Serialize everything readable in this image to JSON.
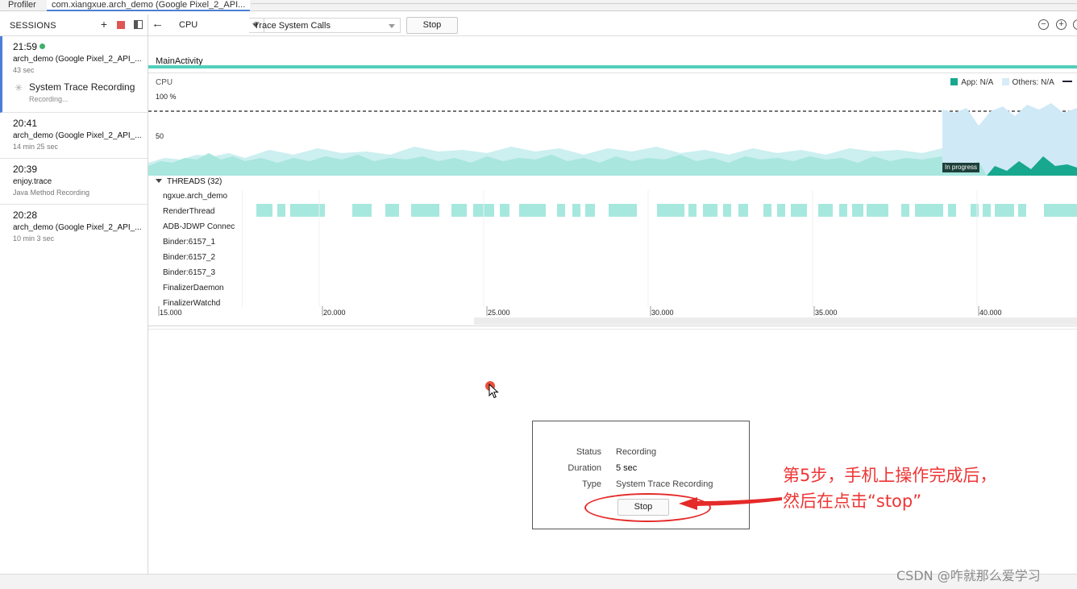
{
  "tabs": {
    "profiler": "Profiler",
    "session": "com.xiangxue.arch_demo (Google Pixel_2_API..."
  },
  "sidebar": {
    "title": "SESSIONS",
    "add_icon": "+",
    "sessions": [
      {
        "time": "21:59",
        "name": "arch_demo (Google Pixel_2_API_...",
        "duration": "43 sec",
        "recording_title": "System Trace Recording",
        "recording_status": "Recording..."
      },
      {
        "time": "20:41",
        "name": "arch_demo (Google Pixel_2_API_...",
        "duration": "14 min 25 sec"
      },
      {
        "time": "20:39",
        "name": "enjoy.trace",
        "duration": "Java Method Recording"
      },
      {
        "time": "20:28",
        "name": "arch_demo (Google Pixel_2_API_...",
        "duration": "10 min 3 sec"
      }
    ]
  },
  "toolbar": {
    "back_icon": "←",
    "monitor": "CPU",
    "trace_config": "Trace System Calls",
    "stop_label": "Stop",
    "zoom_out": "−",
    "zoom_in": "+",
    "zoom_reset": ""
  },
  "timeline": {
    "activity": "MainActivity",
    "cpu_label": "CPU",
    "cpu_max": "100 %",
    "cpu_mid": "50",
    "legend": {
      "app": "App: N/A",
      "others": "Others: N/A"
    },
    "in_progress": "In progress",
    "threads_header": "THREADS (32)",
    "threads": [
      "ngxue.arch_demo",
      "RenderThread",
      "ADB-JDWP Connec",
      "Binder:6157_1",
      "Binder:6157_2",
      "Binder:6157_3",
      "FinalizerDaemon",
      "FinalizerWatchd"
    ],
    "axis_labels": [
      "15.000",
      "20.000",
      "25.000",
      "30.000",
      "35.000",
      "40.000"
    ]
  },
  "status_panel": {
    "status_key": "Status",
    "status_value": "Recording",
    "duration_key": "Duration",
    "duration_value": "5 sec",
    "type_key": "Type",
    "type_value": "System Trace Recording",
    "stop_label": "Stop"
  },
  "annotation": {
    "line1": "第5步，手机上操作完成后，",
    "line2": "然后在点击“stop”"
  },
  "watermark": "CSDN @咋就那么爱学习",
  "colors": {
    "accent": "#4a7fd6",
    "app_cpu": "#17a88f",
    "others_cpu": "#d6ecf7",
    "thread_state": "#a6e8de",
    "annotation": "#ef3535"
  }
}
